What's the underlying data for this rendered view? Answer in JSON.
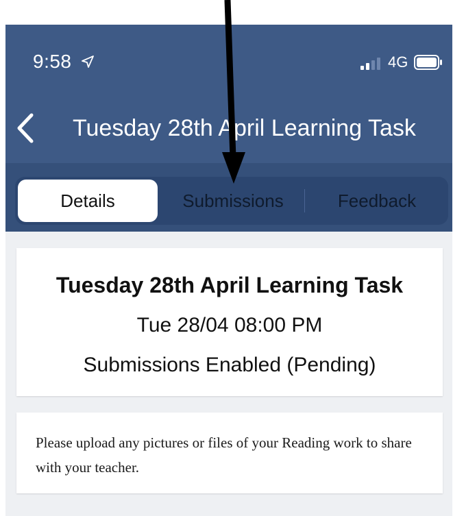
{
  "status_bar": {
    "time": "9:58",
    "network": "4G",
    "icons": [
      "location-arrow-icon",
      "signal-bars-icon",
      "battery-icon"
    ]
  },
  "nav": {
    "back_icon": "chevron-left-icon",
    "title": "Tuesday 28th April Learning Task"
  },
  "tabs": [
    {
      "label": "Details",
      "selected": true
    },
    {
      "label": "Submissions",
      "selected": false
    },
    {
      "label": "Feedback",
      "selected": false
    }
  ],
  "summary_card": {
    "title": "Tuesday 28th April Learning Task",
    "date": "Tue 28/04 08:00 PM",
    "status": "Submissions Enabled (Pending)"
  },
  "description_card": {
    "text": "Please upload any pictures or files of your Reading work to share with your teacher."
  },
  "colors": {
    "header": "#3e5a86",
    "tab_strip": "#35507a",
    "segmented_bg": "#2c4670",
    "page_bg": "#eef0f3",
    "card_bg": "#ffffff",
    "arrow": "#000000"
  }
}
